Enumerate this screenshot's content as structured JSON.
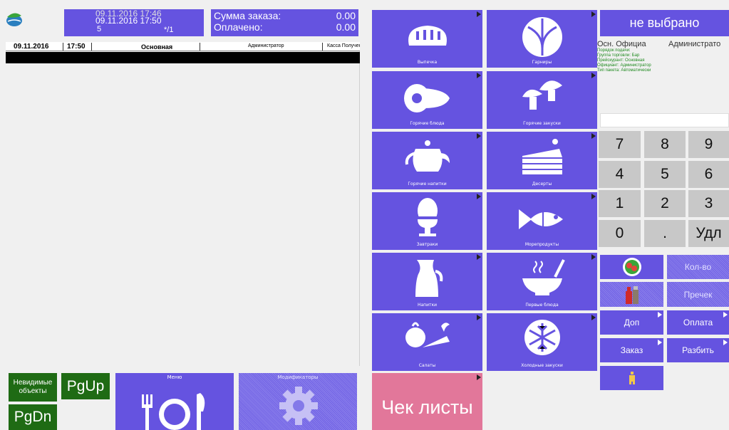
{
  "header": {
    "datetime_line1": "09.11.2016 17:46",
    "datetime_line2": "09.11.2016 17:50",
    "guests": "5",
    "table_index": "*/1",
    "order_sum_label": "Сумма заказа:",
    "order_sum_value": "0.00",
    "paid_label": "Оплачено:",
    "paid_value": "0.00"
  },
  "order_table": {
    "date": "09.11.2016",
    "time": "17:50",
    "menu": "Основная",
    "waiter": "Администратор",
    "cashier": "Касса Получен"
  },
  "bottom_left": {
    "invisible_objects": "Невидимые объекты",
    "pgup": "PgUp",
    "pgdn": "PgDn",
    "menu_label": "Меню",
    "modifiers_label": "Модификаторы"
  },
  "checklists_label": "Чек листы",
  "categories": [
    {
      "label": "Выпечка",
      "icon": "bread-icon"
    },
    {
      "label": "Гарниры",
      "icon": "cabbage-icon"
    },
    {
      "label": "Горячие блюда",
      "icon": "ham-icon"
    },
    {
      "label": "Горячие закуски",
      "icon": "mushrooms-icon"
    },
    {
      "label": "Горячие напитки",
      "icon": "teapot-icon"
    },
    {
      "label": "Десерты",
      "icon": "cake-icon"
    },
    {
      "label": "Завтраки",
      "icon": "egg-icon"
    },
    {
      "label": "Морепродукты",
      "icon": "fish-icon"
    },
    {
      "label": "Напитки",
      "icon": "jug-icon"
    },
    {
      "label": "Первые блюда",
      "icon": "soup-bowl-icon"
    },
    {
      "label": "Салаты",
      "icon": "vegetables-icon"
    },
    {
      "label": "Холодные закуски",
      "icon": "snowflake-icon"
    }
  ],
  "right_panel": {
    "selection": "не выбрано",
    "main_waiter_label": "Осн. Официа",
    "main_waiter_value": "Администрато",
    "info_lines": [
      "Порядок подачи:",
      "Группа торговли: Бар",
      "Прейскурант: Основная",
      "Официант: Администратор",
      "Тип пакета: Автоматически"
    ],
    "keypad": [
      "7",
      "8",
      "9",
      "4",
      "5",
      "6",
      "1",
      "2",
      "3",
      "0",
      ".",
      "Удл"
    ],
    "quantity": "Кол-во",
    "reprint": "Пречек",
    "extra": "Доп",
    "payment": "Оплата",
    "order": "Заказ",
    "split": "Разбить"
  },
  "colors": {
    "tile": "#6553e0",
    "green": "#1f6b14",
    "checklist": "#e2779a"
  }
}
